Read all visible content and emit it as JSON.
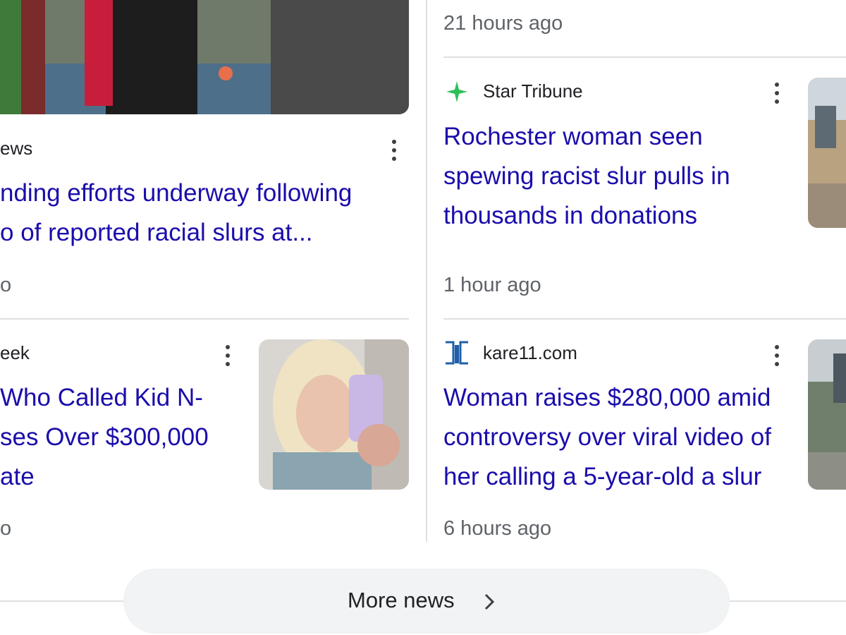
{
  "left_column": {
    "card1": {
      "source": "ews",
      "headline_line1": "nding efforts underway following",
      "headline_line2": "o of reported racial slurs at...",
      "time": "o"
    },
    "card2": {
      "source": "eek",
      "headline_line1": "Who Called Kid N-",
      "headline_line2": "ses Over $300,000",
      "headline_line3": "ate",
      "time": "o"
    }
  },
  "right_column": {
    "top_time": "21 hours ago",
    "card1": {
      "source": "Star Tribune",
      "icon": "star-tribune-logo-icon",
      "headline_line1": "Rochester woman seen",
      "headline_line2": "spewing racist slur pulls in",
      "headline_line3": "thousands in donations",
      "time": "1 hour ago"
    },
    "card2": {
      "source": "kare11.com",
      "icon": "kare11-logo-icon",
      "headline_line1": "Woman raises $280,000 amid",
      "headline_line2": "controversy over viral video of",
      "headline_line3": "her calling a 5-year-old a slur",
      "time": "6 hours ago"
    }
  },
  "more_news": {
    "label": "More news"
  },
  "colors": {
    "link": "#1a0dab",
    "meta": "#5f6368",
    "divider": "#e0e0e0",
    "button_bg": "#f1f3f4"
  }
}
